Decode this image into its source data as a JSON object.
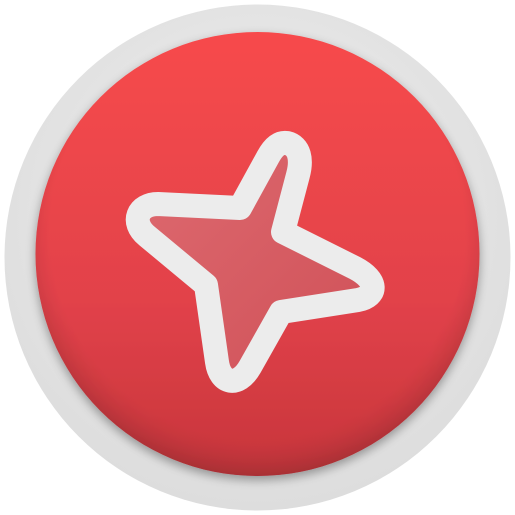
{
  "icon": {
    "name": "four-point-star-icon",
    "shape": "circle-badge-with-star",
    "colors": {
      "outer_ring": "#e6e6e6",
      "outer_ring_shadow": "#d6d6d6",
      "badge_top": "#f54b4d",
      "badge_bottom": "#c8383d",
      "badge_rim_dark": "#9a2b30",
      "star_fill": "#d65a60",
      "star_stroke": "#ececec"
    }
  }
}
